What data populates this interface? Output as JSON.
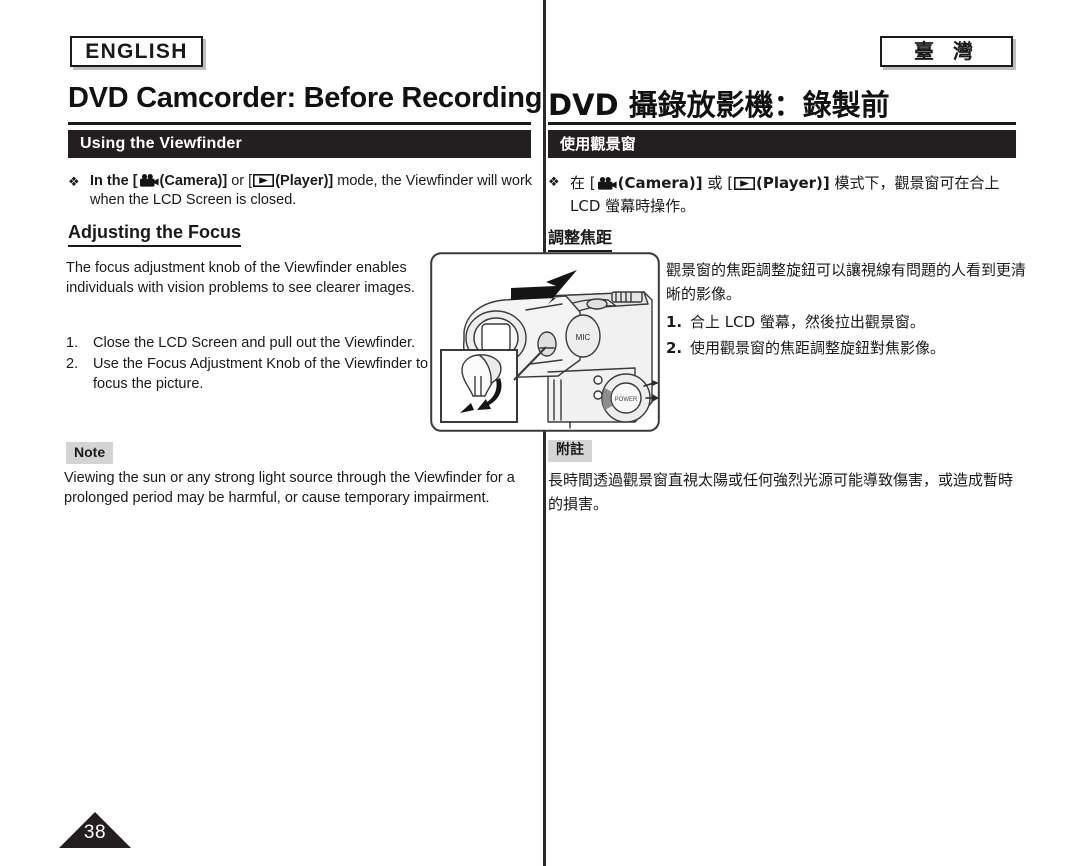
{
  "document": {
    "page_number": "38"
  },
  "left": {
    "language_tag": "ENGLISH",
    "page_title": "DVD Camcorder: Before Recording",
    "section_bar": "Using the Viewfinder",
    "bullet": {
      "marker": "❖",
      "text_part1": "In the [",
      "camera_icon": "camera-icon",
      "camera_label": "(Camera)]",
      "text_part2": " or [",
      "player_icon": "player-icon",
      "player_label": "(Player)]",
      "text_part3": " mode, the Viewfinder will work when the LCD Screen is closed."
    },
    "subhead": "Adjusting the Focus",
    "body_paragraph": "The focus adjustment knob of the Viewfinder enables individuals with vision problems to see clearer images.",
    "steps": [
      {
        "index": "1.",
        "text": "Close the LCD Screen and pull out the Viewfinder."
      },
      {
        "index": "2.",
        "text": "Use the Focus Adjustment Knob of the Viewfinder to focus the picture."
      }
    ],
    "note_tag": "Note",
    "note_text": "Viewing the sun or any strong light source through the Viewfinder for a prolonged period may be harmful, or cause temporary impairment."
  },
  "right": {
    "language_tag": "臺 灣",
    "page_title": "DVD 攝錄放影機：錄製前",
    "section_bar": "使用觀景窗",
    "bullet": {
      "marker": "❖",
      "text_part1": "在 [",
      "camera_icon": "camera-icon",
      "camera_label": "(Camera)]",
      "text_part2": " 或 [",
      "player_icon": "player-icon",
      "player_label": "(Player)]",
      "text_part3": " 模式下，觀景窗可在合上 LCD 螢幕時操作。"
    },
    "subhead": "調整焦距",
    "body_paragraph": "觀景窗的焦距調整旋鈕可以讓視線有問題的人看到更清晰的影像。",
    "steps": [
      {
        "index": "1.",
        "text": "合上 LCD 螢幕，然後拉出觀景窗。"
      },
      {
        "index": "2.",
        "text": "使用觀景窗的焦距調整旋鈕對焦影像。"
      }
    ],
    "note_tag": "附註",
    "note_text": "長時間透過觀景窗直視太陽或任何強烈光源可能導致傷害，或造成暫時的損害。"
  },
  "illustration": {
    "name": "camcorder-viewfinder-diagram",
    "mic_label": "MIC",
    "power_label": "POWER"
  },
  "colors": {
    "bar_background": "#231f20",
    "bar_text": "#ffffff",
    "note_tag_background": "#d4d4d4",
    "rule": "#1a1a1a",
    "page_text": "#1a1a1a"
  }
}
